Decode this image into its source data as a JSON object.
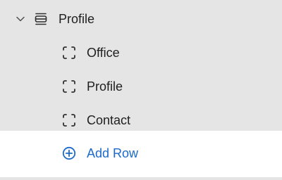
{
  "tree": {
    "parent": {
      "label": "Profile",
      "expanded": true,
      "icon": "section-rows-icon",
      "chevron_icon": "chevron-down-icon"
    },
    "children": [
      {
        "label": "Office",
        "icon": "dashed-square-icon"
      },
      {
        "label": "Profile",
        "icon": "dashed-square-icon"
      },
      {
        "label": "Contact",
        "icon": "dashed-square-icon"
      }
    ]
  },
  "add_row": {
    "label": "Add Row",
    "icon": "plus-circle-icon",
    "color": "#1b6ac9"
  },
  "colors": {
    "tree_background": "#e5e5e5",
    "text": "#202020",
    "accent": "#1b6ac9"
  }
}
